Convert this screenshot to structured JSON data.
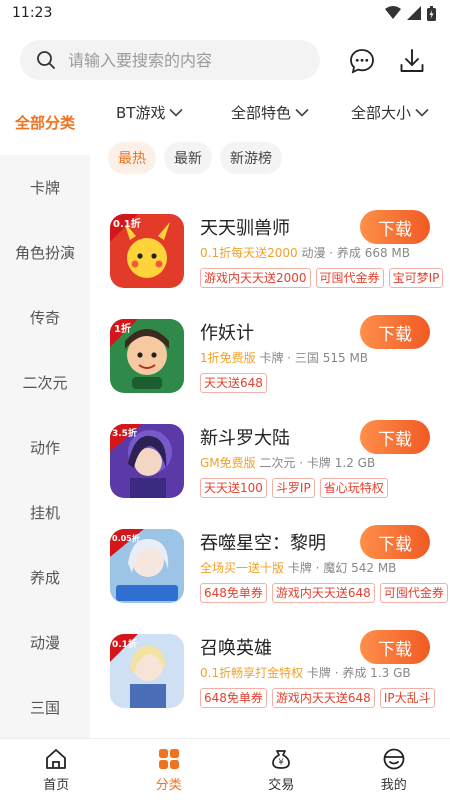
{
  "status": {
    "time": "11:23"
  },
  "search": {
    "placeholder": "请输入要搜索的内容"
  },
  "sidebar": {
    "items": [
      {
        "label": "全部分类",
        "active": true
      },
      {
        "label": "卡牌"
      },
      {
        "label": "角色扮演"
      },
      {
        "label": "传奇"
      },
      {
        "label": "二次元"
      },
      {
        "label": "动作"
      },
      {
        "label": "挂机"
      },
      {
        "label": "养成"
      },
      {
        "label": "动漫"
      },
      {
        "label": "三国"
      }
    ]
  },
  "filters": {
    "type": "BT游戏",
    "feature": "全部特色",
    "size": "全部大小"
  },
  "sort": {
    "tabs": [
      {
        "label": "最热",
        "active": true
      },
      {
        "label": "最新"
      },
      {
        "label": "新游榜"
      }
    ]
  },
  "games": [
    {
      "name": "天天驯兽师",
      "promo": "0.1折每天送2000",
      "meta": "动漫 · 养成  668 MB",
      "tags": [
        "游戏内天天送2000",
        "可囤代金券",
        "宝可梦IP"
      ],
      "icon_badge": "0.1折",
      "download_label": "下载"
    },
    {
      "name": "作妖计",
      "promo": "1折免费版",
      "meta": "卡牌 · 三国  515 MB",
      "tags": [
        "天天送648"
      ],
      "icon_badge": "1折",
      "download_label": "下载"
    },
    {
      "name": "新斗罗大陆",
      "promo": "GM免费版",
      "meta": "二次元 · 卡牌  1.2 GB",
      "tags": [
        "天天送100",
        "斗罗IP",
        "省心玩特权"
      ],
      "icon_badge": "3.5折",
      "download_label": "下载"
    },
    {
      "name": "吞噬星空：黎明",
      "promo": "全场买一送十版",
      "meta": "卡牌 · 魔幻  542 MB",
      "tags": [
        "648免单券",
        "游戏内天天送648",
        "可囤代金券"
      ],
      "icon_badge": "0.05折",
      "download_label": "下载"
    },
    {
      "name": "召唤英雄",
      "promo": "0.1折畅享打金特权",
      "meta": "卡牌 · 养成  1.3 GB",
      "tags": [
        "648免单券",
        "游戏内天天送648",
        "IP大乱斗"
      ],
      "icon_badge": "0.1折",
      "download_label": "下载"
    }
  ],
  "bottom_nav": {
    "items": [
      {
        "label": "首页",
        "icon": "home-icon"
      },
      {
        "label": "分类",
        "icon": "category-icon",
        "active": true
      },
      {
        "label": "交易",
        "icon": "trade-icon"
      },
      {
        "label": "我的",
        "icon": "profile-icon"
      }
    ]
  },
  "colors": {
    "accent": "#f07320",
    "promo": "#f0a22a",
    "tag": "#e2412e"
  }
}
